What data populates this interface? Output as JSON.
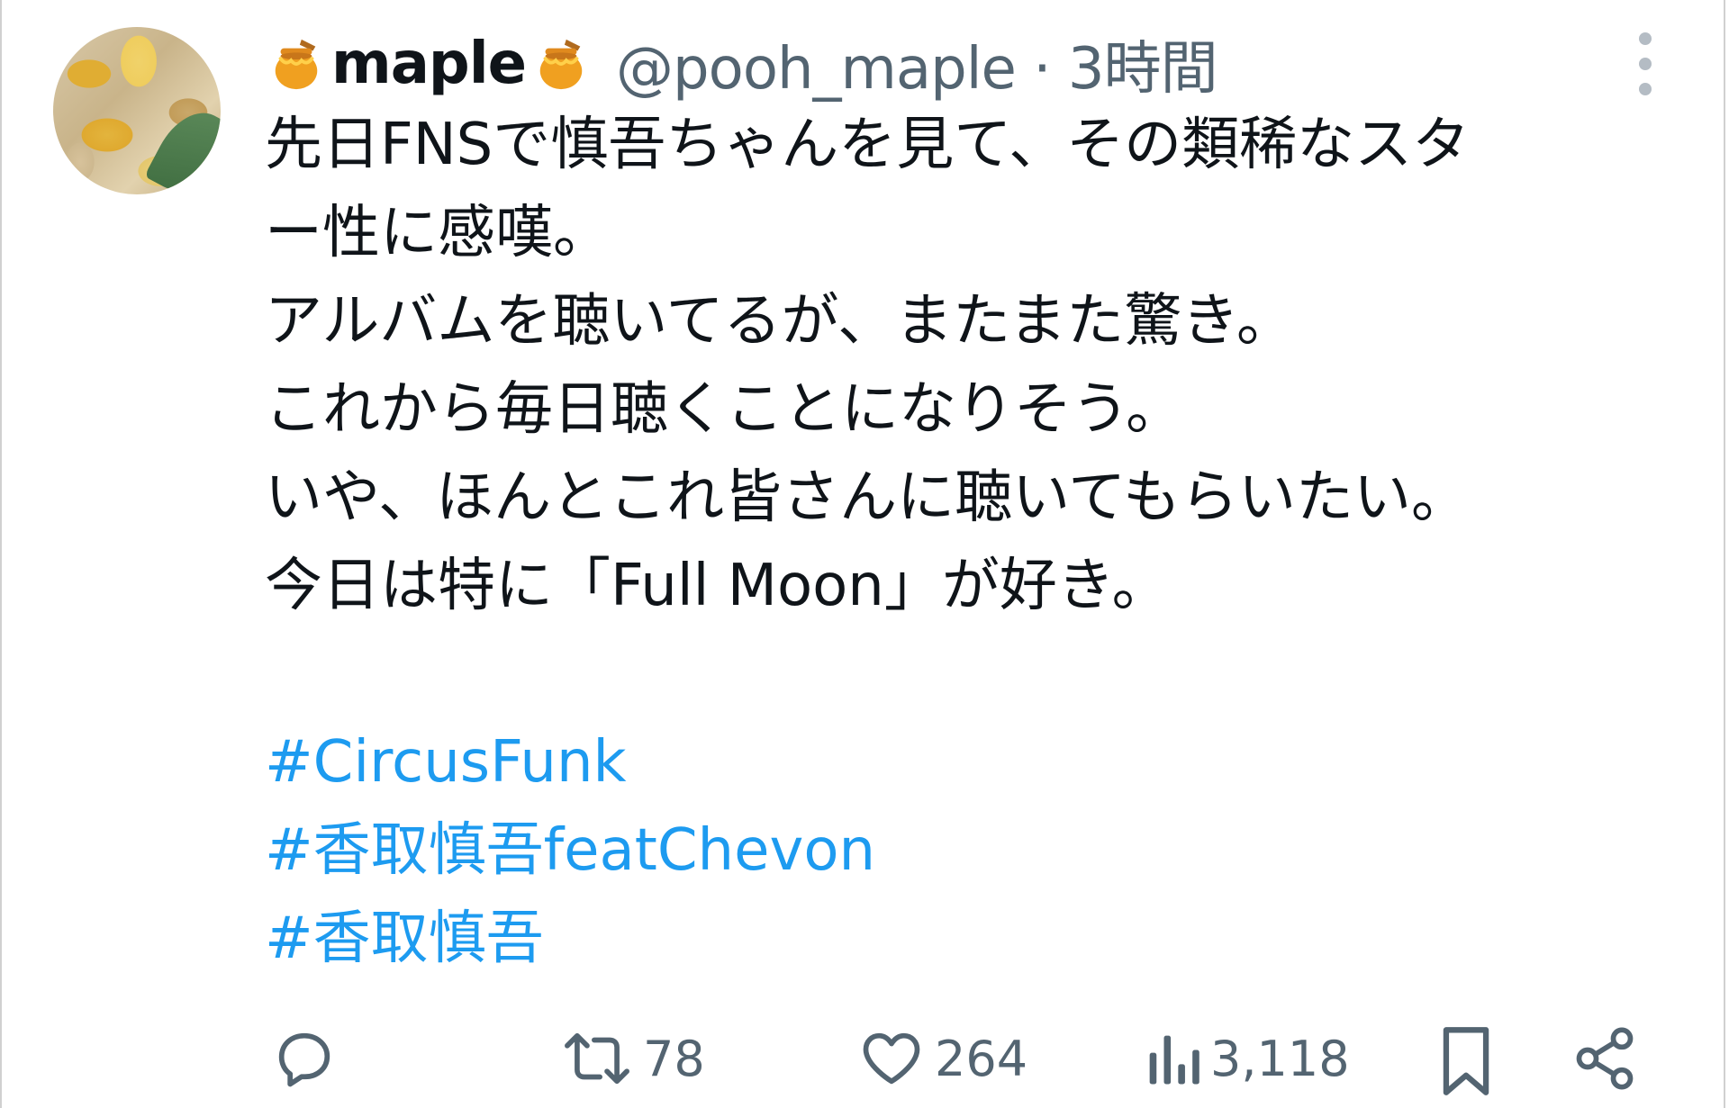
{
  "post": {
    "user": {
      "display_name": "maple",
      "name_emoji_left": "honey-pot-icon",
      "name_emoji_right": "honey-pot-icon",
      "handle_time": "@pooh_maple · 3時間"
    },
    "text_lines": [
      "先日FNSで慎吾ちゃんを見て、その類稀なスタ",
      "ー性に感嘆。",
      "アルバムを聴いてるが、またまた驚き。",
      "これから毎日聴くことになりそう。",
      "いや、ほんとこれ皆さんに聴いてもらいたい。",
      "今日は特に「Full Moon」が好き。"
    ],
    "hashtags": [
      "#CircusFunk",
      "#香取慎吾featChevon",
      "#香取慎吾"
    ],
    "actions": {
      "reply_icon": "reply-icon",
      "retweet_count": "78",
      "like_count": "264",
      "views_count": "3,118",
      "bookmark_icon": "bookmark-icon",
      "share_icon": "share-icon"
    }
  },
  "colors": {
    "text": "#0f1419",
    "secondary": "#536471",
    "link": "#1d9bf0"
  }
}
